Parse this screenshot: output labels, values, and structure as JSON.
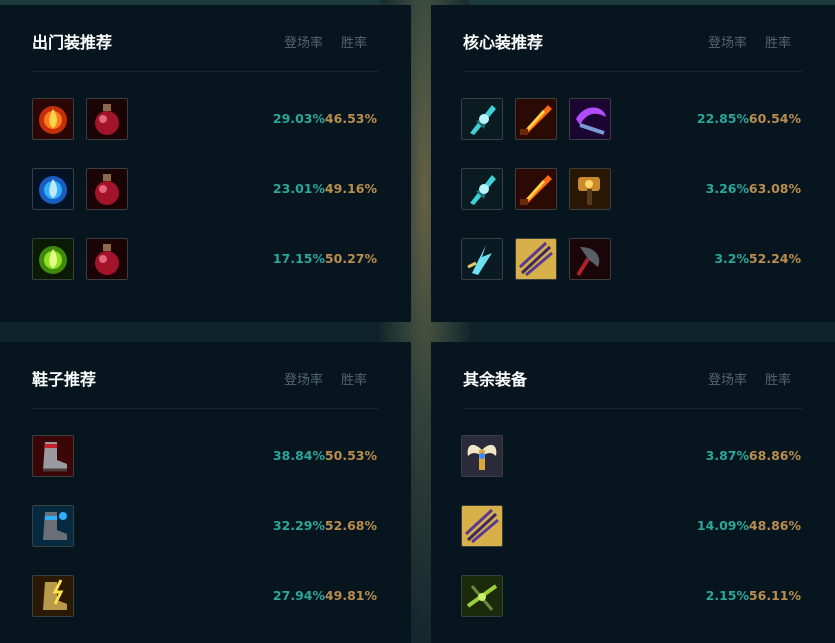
{
  "columns": {
    "pick_rate": "登场率",
    "win_rate": "胜率"
  },
  "colors": {
    "pick": "#2aa69a",
    "win": "#b98d4e",
    "panel": "#07161e",
    "title": "#ffffff"
  },
  "panels": [
    {
      "title": "出门装推荐",
      "rows": [
        {
          "items": [
            "fire-orb-icon",
            "health-potion-icon"
          ],
          "pick": "29.03%",
          "win": "46.53%"
        },
        {
          "items": [
            "water-orb-icon",
            "health-potion-icon"
          ],
          "pick": "23.01%",
          "win": "49.16%"
        },
        {
          "items": [
            "nature-orb-icon",
            "health-potion-icon"
          ],
          "pick": "17.15%",
          "win": "50.27%"
        }
      ]
    },
    {
      "title": "核心装推荐",
      "rows": [
        {
          "items": [
            "frost-blade-icon",
            "flame-sword-icon",
            "purple-scythe-icon"
          ],
          "pick": "22.85%",
          "win": "60.54%"
        },
        {
          "items": [
            "frost-blade-icon",
            "flame-sword-icon",
            "golden-hammer-icon"
          ],
          "pick": "3.26%",
          "win": "63.08%"
        },
        {
          "items": [
            "lightning-claw-icon",
            "arrow-volley-icon",
            "dark-axe-icon"
          ],
          "pick": "3.2%",
          "win": "52.24%"
        }
      ]
    },
    {
      "title": "鞋子推荐",
      "rows": [
        {
          "items": [
            "red-boots-icon"
          ],
          "pick": "38.84%",
          "win": "50.53%"
        },
        {
          "items": [
            "blue-boots-icon"
          ],
          "pick": "32.29%",
          "win": "52.68%"
        },
        {
          "items": [
            "lightning-boots-icon"
          ],
          "pick": "27.94%",
          "win": "49.81%"
        }
      ]
    },
    {
      "title": "其余装备",
      "rows": [
        {
          "items": [
            "angel-wings-icon"
          ],
          "pick": "3.87%",
          "win": "68.86%"
        },
        {
          "items": [
            "arrow-volley-icon"
          ],
          "pick": "14.09%",
          "win": "48.86%"
        },
        {
          "items": [
            "green-crossbow-icon"
          ],
          "pick": "2.15%",
          "win": "56.11%"
        }
      ]
    }
  ]
}
